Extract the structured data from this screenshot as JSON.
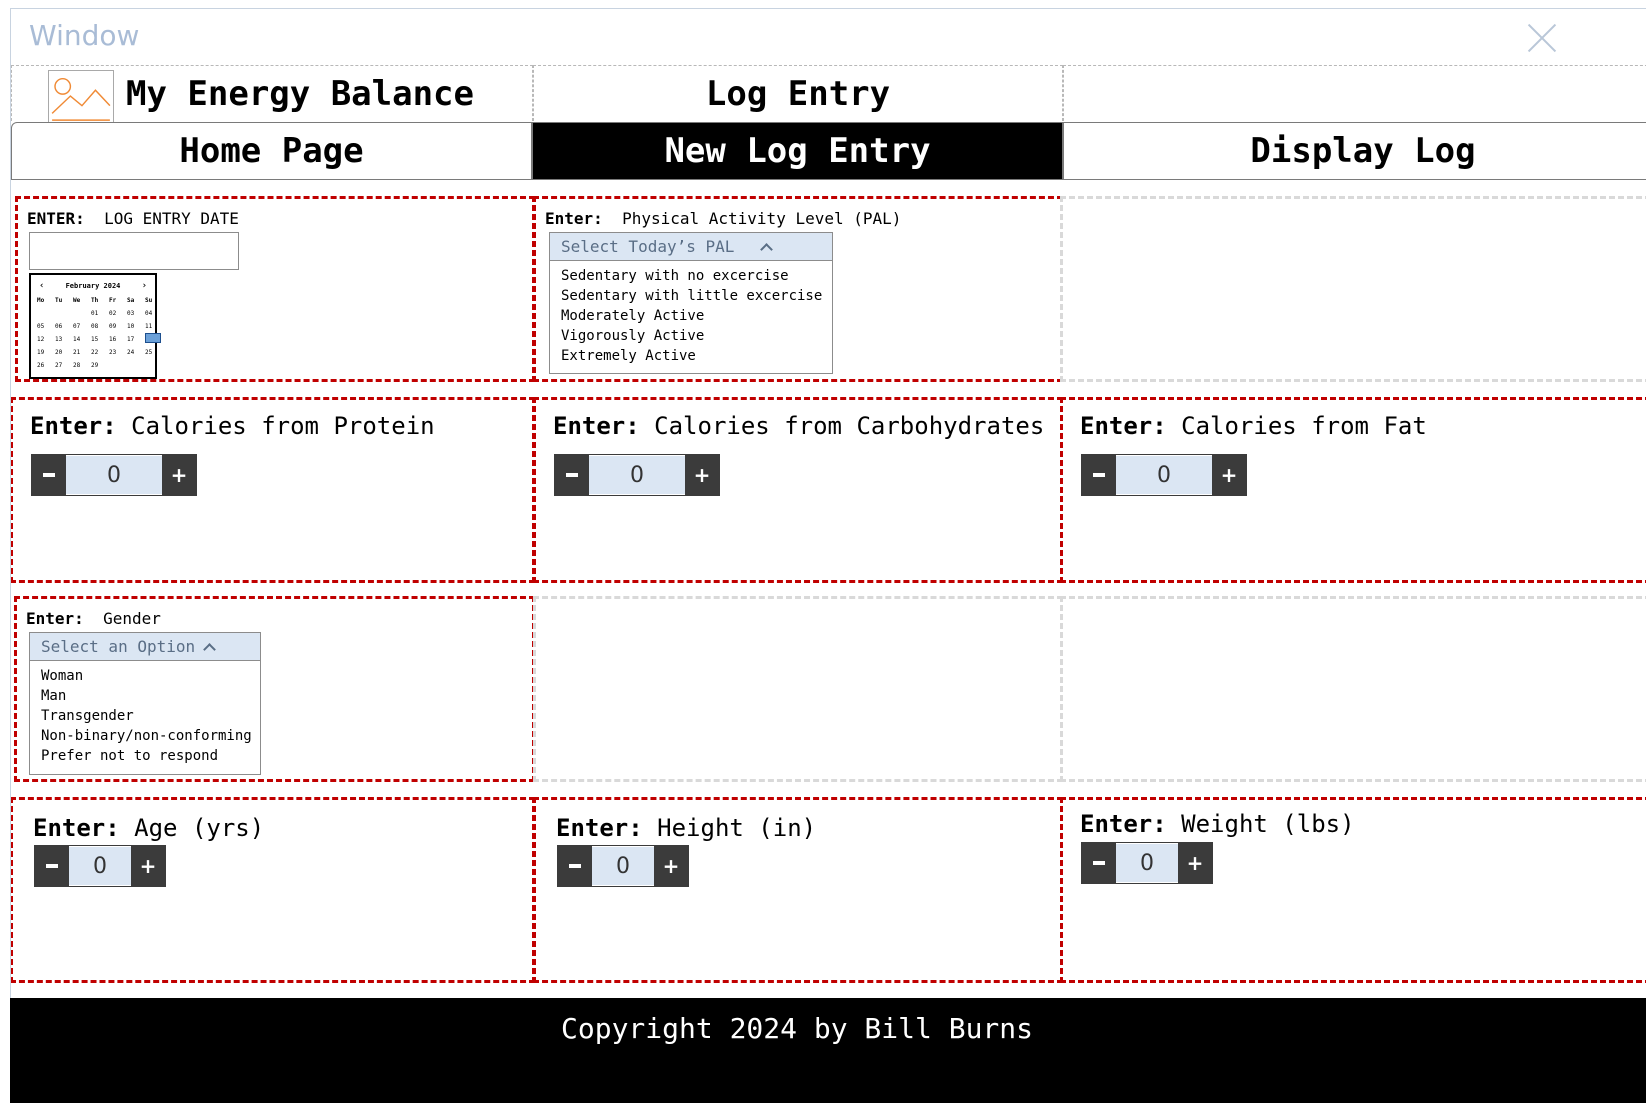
{
  "window": {
    "title": "Window"
  },
  "header": {
    "app_title": "My Energy Balance",
    "page_title": "Log Entry",
    "logo_icon": "image-placeholder-icon"
  },
  "nav": {
    "items": [
      {
        "label": "Home Page",
        "active": false
      },
      {
        "label": "New Log Entry",
        "active": true
      },
      {
        "label": "Display Log",
        "active": false
      }
    ]
  },
  "date_entry": {
    "prefix": "ENTER:",
    "label": "LOG ENTRY DATE",
    "value": "",
    "calendar": {
      "month": "February 2024",
      "weekdays": [
        "Mo",
        "Tu",
        "We",
        "Th",
        "Fr",
        "Sa",
        "Su"
      ],
      "days": [
        "01",
        "02",
        "03",
        "04",
        "05",
        "06",
        "07",
        "08",
        "09",
        "10",
        "11",
        "12",
        "13",
        "14",
        "15",
        "16",
        "17",
        "18",
        "19",
        "20",
        "21",
        "22",
        "23",
        "24",
        "25",
        "26",
        "27",
        "28",
        "29"
      ],
      "selected_day": "18"
    }
  },
  "pal": {
    "prefix": "Enter:",
    "label": "Physical Activity Level (PAL)",
    "placeholder": "Select Today’s PAL",
    "options": [
      "Sedentary with no excercise",
      "Sedentary with little excercise",
      "Moderately Active",
      "Vigorously Active",
      "Extremely Active"
    ]
  },
  "calories": {
    "protein": {
      "prefix": "Enter:",
      "label": "Calories from Protein",
      "value": "0"
    },
    "carbs": {
      "prefix": "Enter:",
      "label": "Calories from Carbohydrates",
      "value": "0"
    },
    "fat": {
      "prefix": "Enter:",
      "label": "Calories from Fat",
      "value": "0"
    }
  },
  "gender": {
    "prefix": "Enter:",
    "label": "Gender",
    "placeholder": "Select an Option",
    "options": [
      "Woman",
      "Man",
      "Transgender",
      "Non-binary/non-conforming",
      "Prefer not to respond"
    ]
  },
  "body": {
    "age": {
      "prefix": "Enter:",
      "label": "Age (yrs)",
      "value": "0"
    },
    "height": {
      "prefix": "Enter:",
      "label": "Height (in)",
      "value": "0"
    },
    "weight": {
      "prefix": "Enter:",
      "label": "Weight (lbs)",
      "value": "0"
    }
  },
  "stepper": {
    "minus": "−",
    "plus": "+"
  },
  "footer": {
    "text": "Copyright 2024 by Bill Burns"
  },
  "colors": {
    "accent_red": "#c00000",
    "nav_active": "#000000",
    "stepper_dark": "#3b3b3b",
    "field_blue": "#dbe6f3"
  }
}
